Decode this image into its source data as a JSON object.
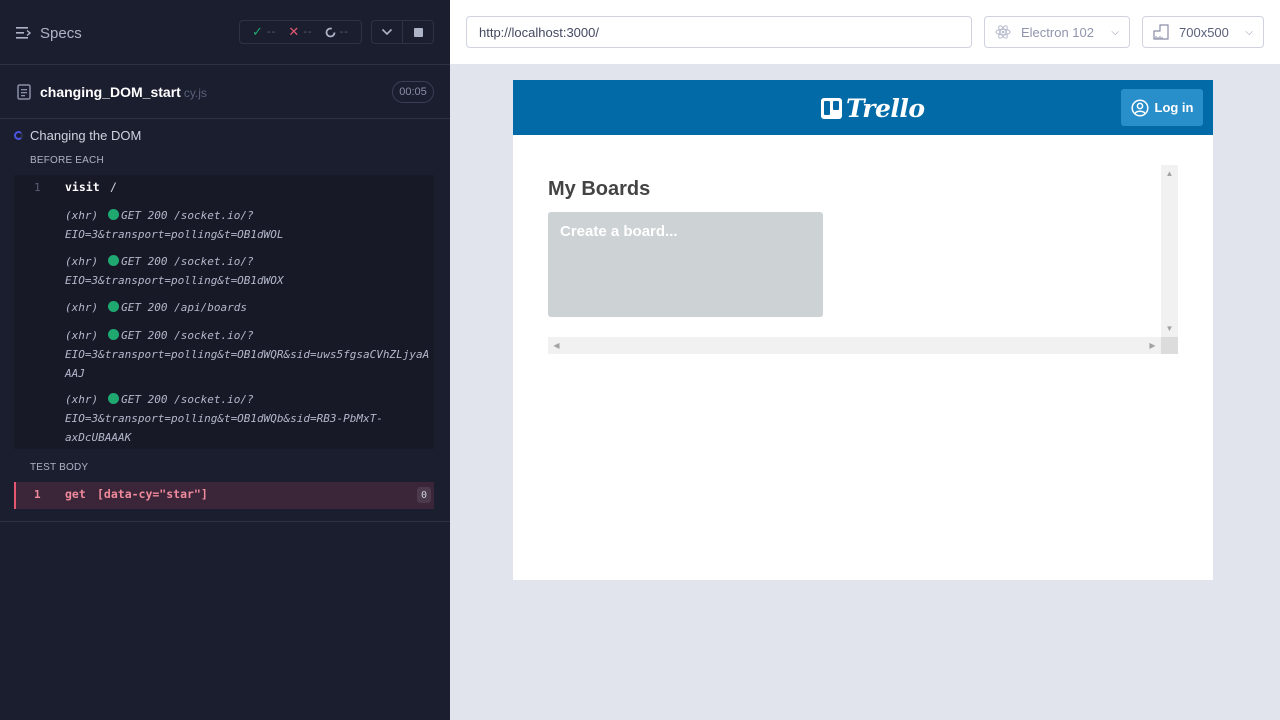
{
  "reporter": {
    "specs_label": "Specs",
    "stats": {
      "passed": "--",
      "failed": "--",
      "pending": "--"
    },
    "file": {
      "name": "changing_DOM_start",
      "ext": "cy.js",
      "duration": "00:05"
    },
    "suite_title": "Changing the DOM",
    "before_each_label": "BEFORE EACH",
    "test_body_label": "TEST BODY",
    "before_each_commands": [
      {
        "num": "1",
        "name": "visit",
        "arg": "/"
      }
    ],
    "xhr_logs": [
      {
        "tag": "(xhr)",
        "line1": "GET 200 /socket.io/?",
        "line2": "EIO=3&transport=polling&t=OB1dWOL",
        "line3": ""
      },
      {
        "tag": "(xhr)",
        "line1": "GET 200 /socket.io/?",
        "line2": "EIO=3&transport=polling&t=OB1dWOX",
        "line3": ""
      },
      {
        "tag": "(xhr)",
        "line1": "GET 200 /api/boards",
        "line2": "",
        "line3": ""
      },
      {
        "tag": "(xhr)",
        "line1": "GET 200 /socket.io/?",
        "line2": "EIO=3&transport=polling&t=OB1dWQR&sid=uws5fgsaCVhZLjyaA",
        "line3": "AAJ"
      },
      {
        "tag": "(xhr)",
        "line1": "GET 200 /socket.io/?",
        "line2": "EIO=3&transport=polling&t=OB1dWQb&sid=RB3-PbMxT-",
        "line3": "axDcUBAAAK"
      }
    ],
    "test_body_command": {
      "num": "1",
      "name": "get",
      "selector": "[data-cy=\"star\"]",
      "badge": "0"
    }
  },
  "toolbar": {
    "url": "http://localhost:3000/",
    "browser": "Electron 102",
    "viewport": "700x500"
  },
  "app": {
    "logo_text": "Trello",
    "login_label": "Log in",
    "boards_title": "My Boards",
    "create_board_label": "Create a board..."
  },
  "colors": {
    "reporter_bg": "#1b1e2e",
    "pass": "#1fa971",
    "fail": "#e45770",
    "trello_blue": "#026aa7",
    "login_blue": "#298fca"
  }
}
